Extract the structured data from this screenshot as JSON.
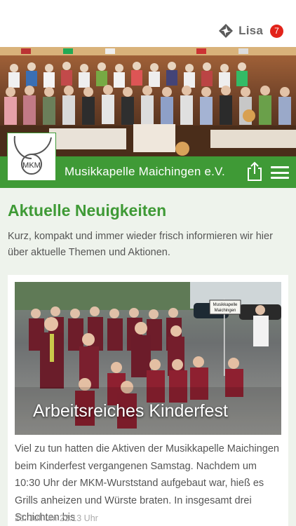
{
  "header": {
    "user_name": "Lisa",
    "notification_count": "7",
    "logo_icon": "diamond-pinwheel-logo"
  },
  "brand": {
    "title": "Musikkapelle Maichingen e.V.",
    "logo_text": "MKM",
    "green": "#3f9a36"
  },
  "main": {
    "section_title": "Aktuelle Neuigkeiten",
    "intro": "Kurz, kompakt und immer wieder frisch informieren wir hier über aktuelle Themen und Aktionen."
  },
  "news": [
    {
      "title": "Arbeitsreiches Kinderfest",
      "sign_text_1": "Musikkapelle",
      "sign_text_2": "Maichingen",
      "excerpt": "Viel zu tun hatten die Aktiven der Musikkapelle Maichingen beim Kinderfest vergangenen Samstag. Nachdem um 10:30 Uhr der MKM-Wurststand aufgebaut war, hieß es Grills anheizen und Würste braten. In insgesamt drei Schichten bis",
      "date": "23. Juli um 22:13 Uhr"
    }
  ]
}
